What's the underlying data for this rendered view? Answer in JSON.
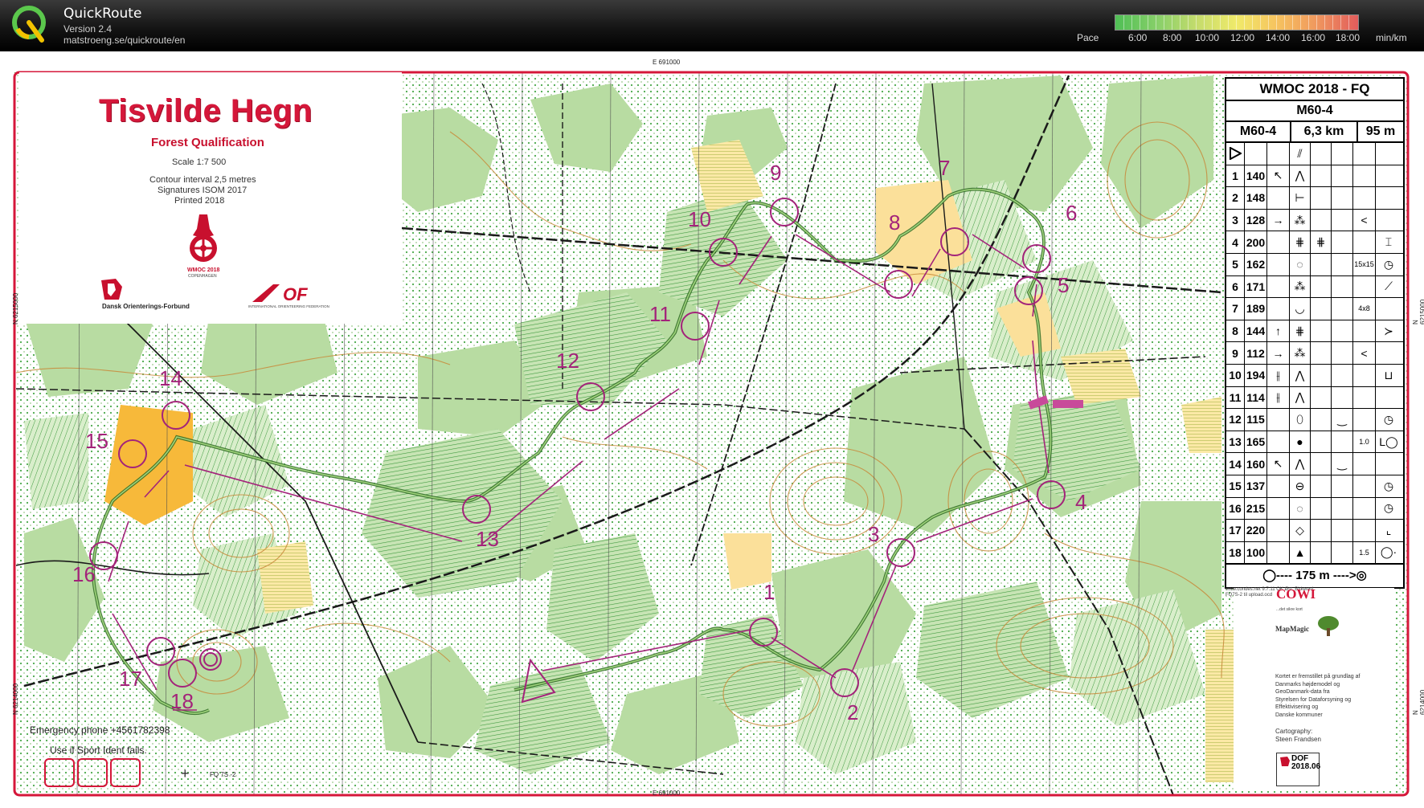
{
  "app": {
    "title": "QuickRoute",
    "version": "Version 2.4",
    "url": "matstroeng.se/quickroute/en"
  },
  "pace_legend": {
    "label": "Pace",
    "ticks": [
      "6:00",
      "8:00",
      "10:00",
      "12:00",
      "14:00",
      "16:00",
      "18:00"
    ],
    "unit": "min/km"
  },
  "map": {
    "title": "Tisvilde Hegn",
    "subtitle": "Forest Qualification",
    "scale": "Scale 1:7 500",
    "contour": "Contour interval 2,5 metres",
    "signatures": "Signatures ISOM 2017",
    "printed": "Printed 2018",
    "wmoc_logo_text": "WMOC 2018",
    "wmoc_logo_sub": "COPENHAGEN",
    "dof_logo_text": "Dansk Orienterings-Forbund",
    "iof_logo_text": "INTERNATIONAL ORIENTEERING FEDERATION",
    "grid_labels": {
      "top": "E 691000",
      "bottom": "E 691000",
      "left_upper": "N 6215000",
      "left_lower": "N 6214000",
      "right_upper": "N 6215000",
      "right_lower": "N 6214000"
    },
    "emergency": "Emergency phone +4561782398",
    "si_note": "Use if Sport Ident fails.",
    "fq_code": "FQ 7S -2",
    "controls": [
      "1",
      "2",
      "3",
      "4",
      "5",
      "6",
      "7",
      "8",
      "9",
      "10",
      "11",
      "12",
      "13",
      "14",
      "15",
      "16",
      "17",
      "18"
    ]
  },
  "description": {
    "event": "WMOC 2018 - FQ",
    "class": "M60-4",
    "class_cell": "M60-4",
    "length": "6,3 km",
    "climb": "95 m",
    "rows": [
      {
        "n": "1",
        "code": "140",
        "c": "↖",
        "d": "⋀",
        "f": "",
        "g": "",
        "h": ""
      },
      {
        "n": "2",
        "code": "148",
        "c": "",
        "d": "⊢",
        "f": "",
        "g": "",
        "h": ""
      },
      {
        "n": "3",
        "code": "128",
        "c": "→",
        "d": "⁂",
        "f": "",
        "g": "<",
        "h": ""
      },
      {
        "n": "4",
        "code": "200",
        "c": "",
        "d": "⋕",
        "e": "⋕",
        "f": "",
        "g": "",
        "h": "⌶"
      },
      {
        "n": "5",
        "code": "162",
        "c": "",
        "d": "◌",
        "f": "",
        "g": "15x15",
        "h": "◷"
      },
      {
        "n": "6",
        "code": "171",
        "c": "",
        "d": "⁂",
        "f": "",
        "g": "",
        "h": "⟋"
      },
      {
        "n": "7",
        "code": "189",
        "c": "",
        "d": "◡",
        "f": "",
        "g": "4x8",
        "h": ""
      },
      {
        "n": "8",
        "code": "144",
        "c": "↑",
        "d": "⋕",
        "f": "",
        "g": "",
        "h": "≻"
      },
      {
        "n": "9",
        "code": "112",
        "c": "→",
        "d": "⁂",
        "f": "",
        "g": "<",
        "h": ""
      },
      {
        "n": "10",
        "code": "194",
        "c": "⫲",
        "d": "⋀",
        "f": "",
        "g": "",
        "h": "⊔"
      },
      {
        "n": "11",
        "code": "114",
        "c": "⫲",
        "d": "⋀",
        "f": "",
        "g": "",
        "h": ""
      },
      {
        "n": "12",
        "code": "115",
        "c": "",
        "d": "⬯",
        "f": "‿",
        "g": "",
        "h": "◷"
      },
      {
        "n": "13",
        "code": "165",
        "c": "",
        "d": "●",
        "f": "",
        "g": "1.0",
        "h": "L◯"
      },
      {
        "n": "14",
        "code": "160",
        "c": "↖",
        "d": "⋀",
        "f": "‿",
        "g": "",
        "h": ""
      },
      {
        "n": "15",
        "code": "137",
        "c": "",
        "d": "⊖",
        "f": "",
        "g": "",
        "h": "◷"
      },
      {
        "n": "16",
        "code": "215",
        "c": "",
        "d": "◌",
        "f": "",
        "g": "",
        "h": "◷"
      },
      {
        "n": "17",
        "code": "220",
        "c": "",
        "d": "◇",
        "f": "",
        "g": "",
        "h": "⌞"
      },
      {
        "n": "18",
        "code": "100",
        "c": "",
        "d": "▲",
        "f": "",
        "g": "1.5",
        "h": "◯·"
      }
    ],
    "finish": "◯---- 175 m ---->◎"
  },
  "credits": {
    "condes": "www.condes.net 9.7.11 OK Øst, Birkerød FQ7S-2 til upload.ocd",
    "cowi": "COWI",
    "cowi_sub": "...det sikre kort",
    "mapmagic": "MapMagic",
    "lines": [
      "Kortet er fremstillet på grundlag af",
      "Danmarks højdemodel og",
      "GeoDanmark-data fra",
      "Styrelsen for Dataforsyning og",
      "Effektivisering og",
      "Danske kommuner"
    ],
    "carto_label": "Cartography:",
    "carto_name": "Steen Frandsen",
    "stamp": "DOF 2018.06"
  },
  "colors": {
    "course": "#a3237a",
    "route": "#3f7a2f",
    "border": "#d5173a",
    "forest": "#b6dba0",
    "open": "#f7b93a"
  }
}
